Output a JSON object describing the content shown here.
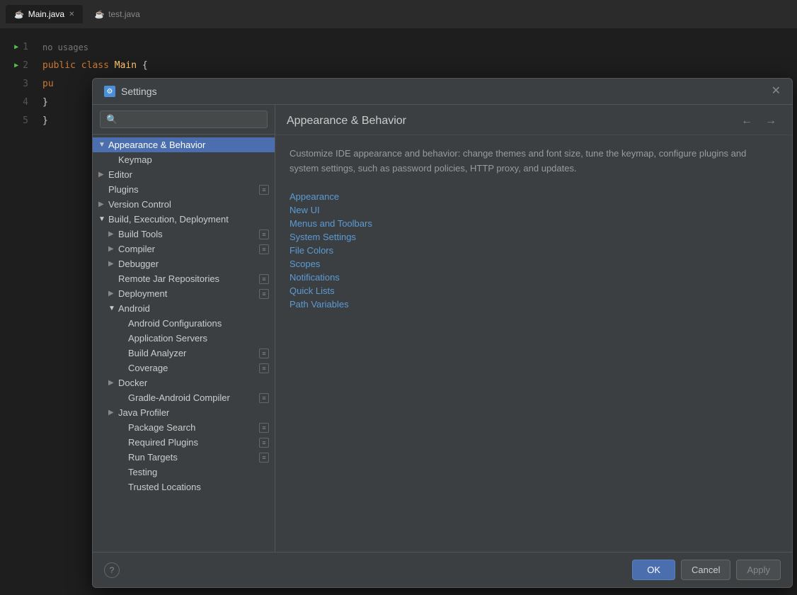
{
  "tabs": [
    {
      "id": "main-java",
      "label": "Main.java",
      "active": true,
      "icon": "orange",
      "closeable": true
    },
    {
      "id": "test-java",
      "label": "test.java",
      "active": false,
      "icon": "gray",
      "closeable": false
    }
  ],
  "editor": {
    "lines": [
      {
        "num": "1",
        "hasRun": true,
        "code": "public class Main {",
        "parts": [
          {
            "text": "public ",
            "class": "kw-public"
          },
          {
            "text": "class ",
            "class": "kw-class"
          },
          {
            "text": "Main",
            "class": "cls-name"
          },
          {
            "text": " {",
            "class": ""
          }
        ]
      },
      {
        "num": "2",
        "hasRun": true,
        "code": "pu",
        "parts": [
          {
            "text": "pu",
            "class": "kw-public"
          }
        ]
      },
      {
        "num": "3",
        "hasRun": false,
        "code": "",
        "parts": []
      },
      {
        "num": "4",
        "hasRun": false,
        "code": "}",
        "parts": [
          {
            "text": "}",
            "class": ""
          }
        ]
      },
      {
        "num": "5",
        "hasRun": false,
        "code": "}",
        "parts": [
          {
            "text": "}",
            "class": ""
          }
        ]
      }
    ],
    "no_usages": "no usages"
  },
  "dialog": {
    "title": "Settings",
    "title_icon": "⚙",
    "back_btn": "←",
    "forward_btn": "→"
  },
  "search": {
    "placeholder": "🔍"
  },
  "tree": [
    {
      "id": "appearance-behavior",
      "label": "Appearance & Behavior",
      "level": 0,
      "hasArrow": true,
      "arrowExpanded": true,
      "selected": true,
      "hasSettings": false
    },
    {
      "id": "keymap",
      "label": "Keymap",
      "level": 1,
      "hasArrow": false,
      "selected": false,
      "hasSettings": false
    },
    {
      "id": "editor",
      "label": "Editor",
      "level": 0,
      "hasArrow": true,
      "arrowExpanded": false,
      "selected": false,
      "hasSettings": false
    },
    {
      "id": "plugins",
      "label": "Plugins",
      "level": 0,
      "hasArrow": false,
      "selected": false,
      "hasSettings": true
    },
    {
      "id": "version-control",
      "label": "Version Control",
      "level": 0,
      "hasArrow": true,
      "arrowExpanded": false,
      "selected": false,
      "hasSettings": false
    },
    {
      "id": "build-execution-deployment",
      "label": "Build, Execution, Deployment",
      "level": 0,
      "hasArrow": true,
      "arrowExpanded": true,
      "selected": false,
      "hasSettings": false
    },
    {
      "id": "build-tools",
      "label": "Build Tools",
      "level": 1,
      "hasArrow": true,
      "arrowExpanded": false,
      "selected": false,
      "hasSettings": true
    },
    {
      "id": "compiler",
      "label": "Compiler",
      "level": 1,
      "hasArrow": true,
      "arrowExpanded": false,
      "selected": false,
      "hasSettings": true
    },
    {
      "id": "debugger",
      "label": "Debugger",
      "level": 1,
      "hasArrow": true,
      "arrowExpanded": false,
      "selected": false,
      "hasSettings": false
    },
    {
      "id": "remote-jar-repositories",
      "label": "Remote Jar Repositories",
      "level": 1,
      "hasArrow": false,
      "selected": false,
      "hasSettings": true
    },
    {
      "id": "deployment",
      "label": "Deployment",
      "level": 1,
      "hasArrow": true,
      "arrowExpanded": false,
      "selected": false,
      "hasSettings": true
    },
    {
      "id": "android",
      "label": "Android",
      "level": 1,
      "hasArrow": true,
      "arrowExpanded": false,
      "selected": false,
      "hasSettings": false
    },
    {
      "id": "android-configurations",
      "label": "Android Configurations",
      "level": 2,
      "hasArrow": false,
      "selected": false,
      "hasSettings": false
    },
    {
      "id": "application-servers",
      "label": "Application Servers",
      "level": 2,
      "hasArrow": false,
      "selected": false,
      "hasSettings": false
    },
    {
      "id": "build-analyzer",
      "label": "Build Analyzer",
      "level": 2,
      "hasArrow": false,
      "selected": false,
      "hasSettings": true
    },
    {
      "id": "coverage",
      "label": "Coverage",
      "level": 2,
      "hasArrow": false,
      "selected": false,
      "hasSettings": true
    },
    {
      "id": "docker",
      "label": "Docker",
      "level": 1,
      "hasArrow": true,
      "arrowExpanded": false,
      "selected": false,
      "hasSettings": false
    },
    {
      "id": "gradle-android-compiler",
      "label": "Gradle-Android Compiler",
      "level": 2,
      "hasArrow": false,
      "selected": false,
      "hasSettings": true
    },
    {
      "id": "java-profiler",
      "label": "Java Profiler",
      "level": 1,
      "hasArrow": true,
      "arrowExpanded": false,
      "selected": false,
      "hasSettings": false
    },
    {
      "id": "package-search",
      "label": "Package Search",
      "level": 2,
      "hasArrow": false,
      "selected": false,
      "hasSettings": true
    },
    {
      "id": "required-plugins",
      "label": "Required Plugins",
      "level": 2,
      "hasArrow": false,
      "selected": false,
      "hasSettings": true
    },
    {
      "id": "run-targets",
      "label": "Run Targets",
      "level": 2,
      "hasArrow": false,
      "selected": false,
      "hasSettings": true
    },
    {
      "id": "testing",
      "label": "Testing",
      "level": 2,
      "hasArrow": false,
      "selected": false,
      "hasSettings": false
    },
    {
      "id": "trusted-locations",
      "label": "Trusted Locations",
      "level": 2,
      "hasArrow": false,
      "selected": false,
      "hasSettings": false
    }
  ],
  "right_panel": {
    "title": "Appearance & Behavior",
    "description": "Customize IDE appearance and behavior: change themes and font size, tune the keymap, configure plugins\nand system settings, such as password policies, HTTP proxy, and updates.",
    "links": [
      {
        "id": "appearance",
        "label": "Appearance"
      },
      {
        "id": "new-ui",
        "label": "New UI"
      },
      {
        "id": "menus-toolbars",
        "label": "Menus and Toolbars"
      },
      {
        "id": "system-settings",
        "label": "System Settings"
      },
      {
        "id": "file-colors",
        "label": "File Colors"
      },
      {
        "id": "scopes",
        "label": "Scopes"
      },
      {
        "id": "notifications",
        "label": "Notifications"
      },
      {
        "id": "quick-lists",
        "label": "Quick Lists"
      },
      {
        "id": "path-variables",
        "label": "Path Variables"
      }
    ]
  },
  "footer": {
    "ok_label": "OK",
    "cancel_label": "Cancel",
    "apply_label": "Apply",
    "help_label": "?"
  }
}
